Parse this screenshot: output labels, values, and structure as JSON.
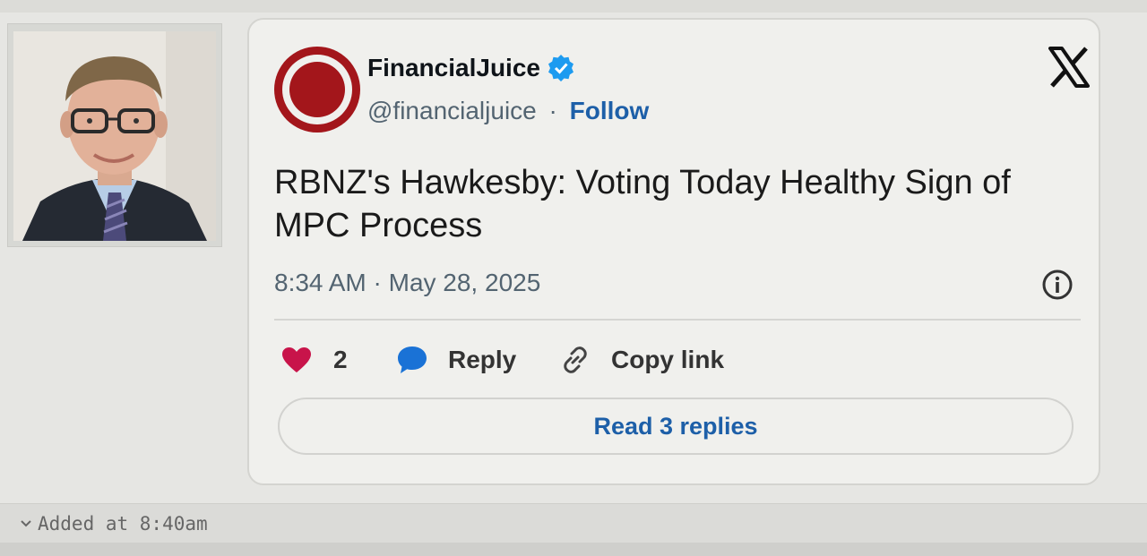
{
  "tweet": {
    "author_name": "FinancialJuice",
    "handle": "@financialjuice",
    "separator": "·",
    "follow_label": "Follow",
    "text": "RBNZ's Hawkesby: Voting Today Healthy Sign of MPC Process",
    "timestamp": "8:34 AM · May 28, 2025",
    "like_count": "2",
    "reply_label": "Reply",
    "copy_link_label": "Copy link",
    "read_replies_label": "Read 3 replies"
  },
  "footer": {
    "added_label": "Added at 8:40am"
  },
  "icons": {
    "avatar": "financialjuice-logo-icon",
    "verified": "verified-badge-icon",
    "platform": "x-logo-icon",
    "info": "info-icon",
    "like": "heart-icon",
    "reply": "speech-bubble-icon",
    "copy": "link-icon",
    "expand": "chevron-down-icon"
  },
  "colors": {
    "brand_red": "#a3161b",
    "link_blue": "#1d5fa8",
    "verified_blue": "#1d9bf0",
    "like_red": "#c8144a",
    "reply_blue": "#1a72d6"
  }
}
